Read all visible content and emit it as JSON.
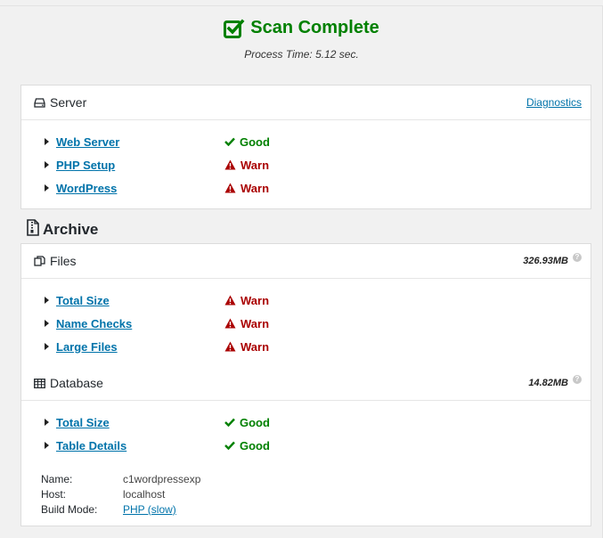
{
  "header": {
    "title": "Scan Complete",
    "process_time": "Process Time: 5.12 sec."
  },
  "server": {
    "title": "Server",
    "diagnostics_link": "Diagnostics",
    "rows": [
      {
        "label": "Web Server",
        "status": "Good"
      },
      {
        "label": "PHP Setup",
        "status": "Warn"
      },
      {
        "label": "WordPress",
        "status": "Warn"
      }
    ]
  },
  "archive": {
    "title": "Archive",
    "files": {
      "title": "Files",
      "size": "326.93MB",
      "help": "?",
      "rows": [
        {
          "label": "Total Size",
          "status": "Warn"
        },
        {
          "label": "Name Checks",
          "status": "Warn"
        },
        {
          "label": "Large Files",
          "status": "Warn"
        }
      ]
    },
    "database": {
      "title": "Database",
      "size": "14.82MB",
      "help": "?",
      "rows": [
        {
          "label": "Total Size",
          "status": "Good"
        },
        {
          "label": "Table Details",
          "status": "Good"
        }
      ],
      "info": {
        "name_label": "Name:",
        "name_value": "c1wordpressexp",
        "host_label": "Host:",
        "host_value": "localhost",
        "build_label": "Build Mode:",
        "build_value": "PHP (slow)"
      }
    }
  },
  "colors": {
    "good": "#008000",
    "warn": "#aa0000",
    "link": "#0073aa"
  }
}
